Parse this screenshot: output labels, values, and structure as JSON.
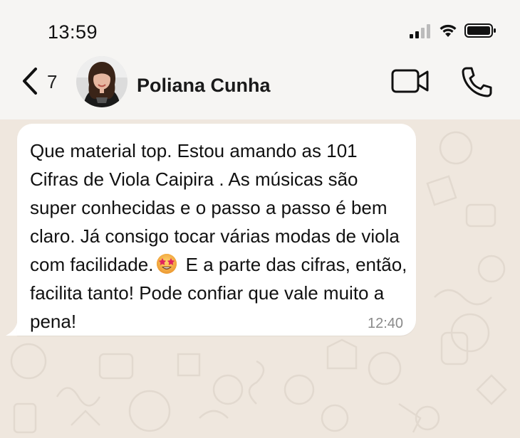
{
  "status_bar": {
    "time": "13:59",
    "icons": [
      "signal-icon",
      "wifi-icon",
      "battery-icon"
    ]
  },
  "header": {
    "back_count": "7",
    "contact_name": "Poliana Cunha",
    "icons": [
      "back-chevron-icon",
      "video-call-icon",
      "phone-icon"
    ]
  },
  "message": {
    "text_part1": "Que material top. Estou amando as 101 Cifras de Viola Caipira . As músicas são super conhecidas e o passo a passo é bem claro. Já consigo tocar várias modas de viola com facilidade.",
    "emoji": "star-struck-emoji",
    "text_part2": " E a parte das cifras, então, facilita tanto! Pode confiar que vale muito a pena!",
    "time": "12:40"
  },
  "colors": {
    "header_bg": "#f6f5f3",
    "chat_bg": "#efe7de",
    "bubble_bg": "#ffffff",
    "time_text": "#8a8a8a"
  }
}
